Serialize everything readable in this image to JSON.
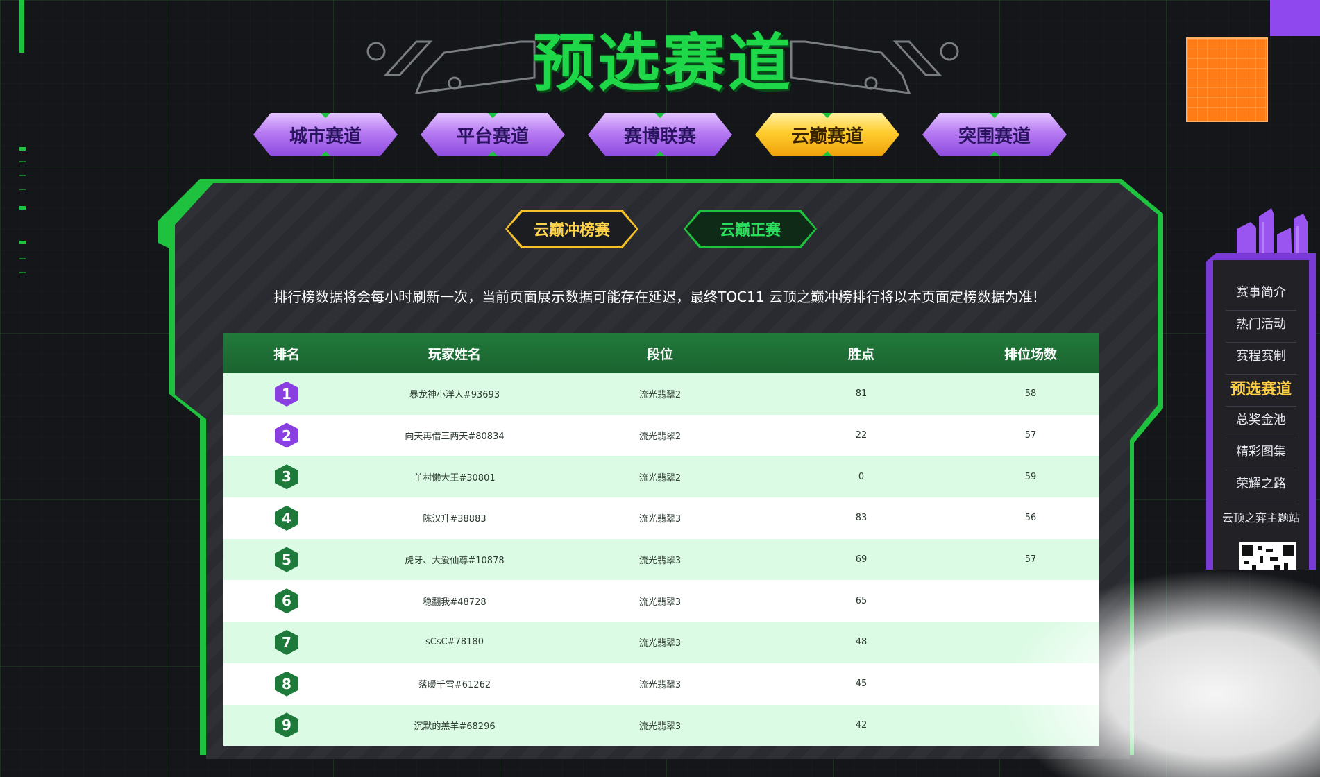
{
  "header": {
    "title": "预选赛道"
  },
  "category_tabs": [
    {
      "label": "城市赛道",
      "active": false
    },
    {
      "label": "平台赛道",
      "active": false
    },
    {
      "label": "赛博联赛",
      "active": false
    },
    {
      "label": "云巅赛道",
      "active": true
    },
    {
      "label": "突围赛道",
      "active": false
    }
  ],
  "sub_tabs": [
    {
      "label": "云巅冲榜赛",
      "active": true
    },
    {
      "label": "云巅正赛",
      "active": false
    }
  ],
  "notice": "排行榜数据将会每小时刷新一次，当前页面展示数据可能存在延迟，最终TOC11 云顶之巅冲榜排行将以本页面定榜数据为准!",
  "table": {
    "columns": [
      "排名",
      "玩家姓名",
      "段位",
      "胜点",
      "排位场数"
    ],
    "rows": [
      {
        "rank": "1",
        "name": "暴龙神小洋人#93693",
        "tier": "流光翡翠2",
        "points": "81",
        "games": "58"
      },
      {
        "rank": "2",
        "name": "向天再借三两天#80834",
        "tier": "流光翡翠2",
        "points": "22",
        "games": "57"
      },
      {
        "rank": "3",
        "name": "羊村懒大王#30801",
        "tier": "流光翡翠2",
        "points": "0",
        "games": "59"
      },
      {
        "rank": "4",
        "name": "陈汉升#38883",
        "tier": "流光翡翠3",
        "points": "83",
        "games": "56"
      },
      {
        "rank": "5",
        "name": "虎牙、大爱仙尊#10878",
        "tier": "流光翡翠3",
        "points": "69",
        "games": "57"
      },
      {
        "rank": "6",
        "name": "稳翻我#48728",
        "tier": "流光翡翠3",
        "points": "65",
        "games": ""
      },
      {
        "rank": "7",
        "name": "sCsC#78180",
        "tier": "流光翡翠3",
        "points": "48",
        "games": ""
      },
      {
        "rank": "8",
        "name": "落暖千雪#61262",
        "tier": "流光翡翠3",
        "points": "45",
        "games": ""
      },
      {
        "rank": "9",
        "name": "沉默的羔羊#68296",
        "tier": "流光翡翠3",
        "points": "42",
        "games": ""
      }
    ]
  },
  "side_nav": {
    "items": [
      {
        "label": "赛事简介",
        "active": false
      },
      {
        "label": "热门活动",
        "active": false
      },
      {
        "label": "赛程赛制",
        "active": false
      },
      {
        "label": "预选赛道",
        "active": true
      },
      {
        "label": "总奖金池",
        "active": false
      },
      {
        "label": "精彩图集",
        "active": false
      },
      {
        "label": "荣耀之路",
        "active": false
      }
    ],
    "site_label": "云顶之弈主题站"
  },
  "colors": {
    "accent_green": "#1ec23e",
    "tab_purple": "#9d5ae6",
    "tab_gold": "#ffc72c",
    "highlight": "#ffd046"
  },
  "icons": [
    "title-circuit-deco-left-icon",
    "title-circuit-deco-right-icon",
    "rank-hexagon-icon",
    "qr-code-icon",
    "purple-city-icon"
  ]
}
